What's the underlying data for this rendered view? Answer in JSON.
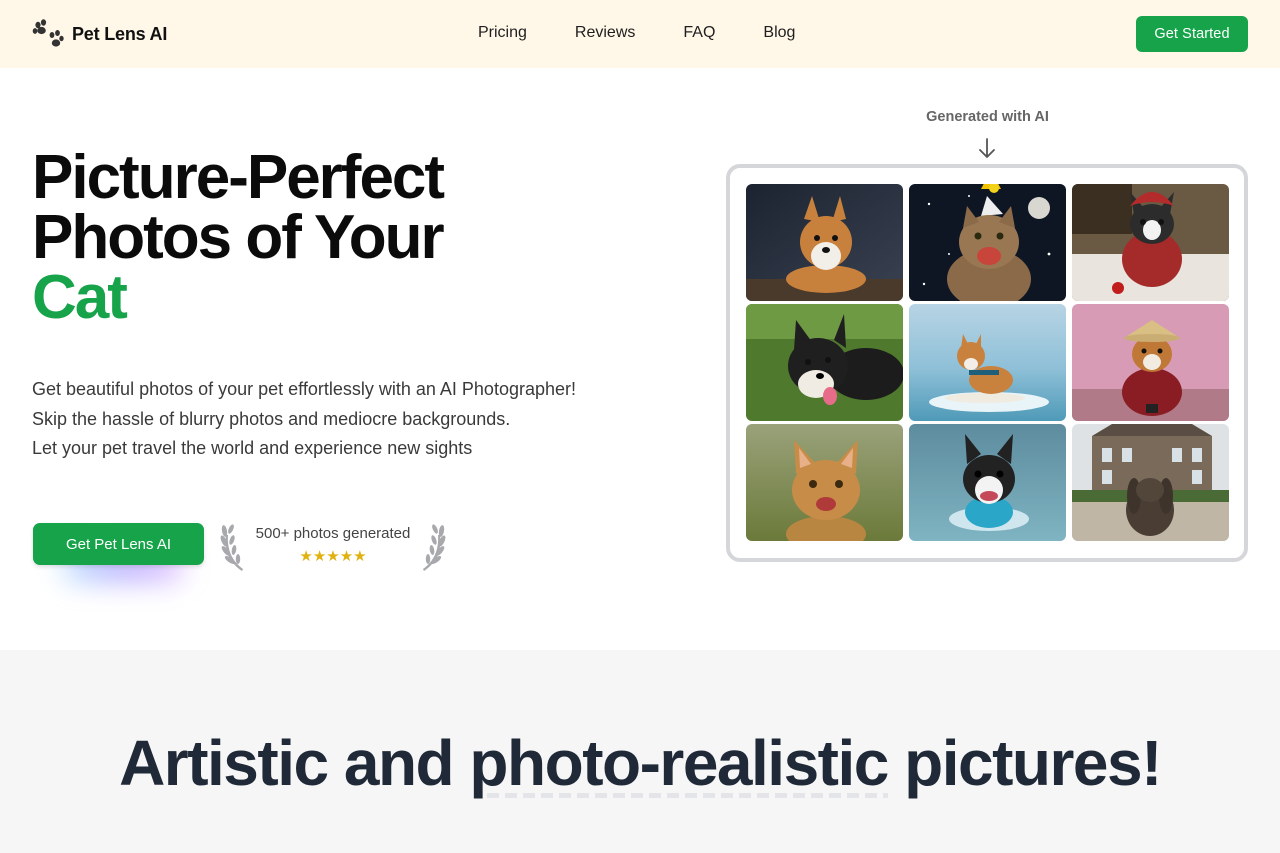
{
  "navbar": {
    "brand_name": "Pet Lens AI",
    "logo_icon": "paw-prints-icon",
    "links": [
      "Pricing",
      "Reviews",
      "FAQ",
      "Blog"
    ],
    "cta": "Get Started"
  },
  "hero": {
    "title_line1": "Picture-Perfect",
    "title_line2": "Photos of Your",
    "title_accent": "Cat",
    "subtitle": [
      "Get beautiful photos of your pet effortlessly with an AI Photographer!",
      "Skip the hassle of blurry photos and mediocre backgrounds.",
      "Let your pet travel the world and experience new sights"
    ],
    "cta": "Get Pet Lens AI",
    "social_proof": {
      "text": "500+ photos generated",
      "stars": "★★★★★",
      "rating": 5
    }
  },
  "gallery": {
    "label": "Generated with AI",
    "arrow_icon": "arrow-down-icon",
    "images": [
      "corgi-photo",
      "cat-party-hat-space-photo",
      "boston-terrier-red-scarf-photo",
      "shiba-inu-grass-photo",
      "corgi-surfing-photo",
      "corgi-kimono-cherry-blossom-photo",
      "ginger-kitten-photo",
      "boston-terrier-swimming-photo",
      "rabbit-manor-photo"
    ]
  },
  "section2": {
    "title_before": "Artistic and ",
    "title_highlight": "photo-realistic",
    "title_after": " pictures!"
  },
  "colors": {
    "brand_green": "#16a34a",
    "nav_bg": "#fff7e8",
    "section_bg": "#f6f6f7",
    "star": "#e0b210"
  }
}
